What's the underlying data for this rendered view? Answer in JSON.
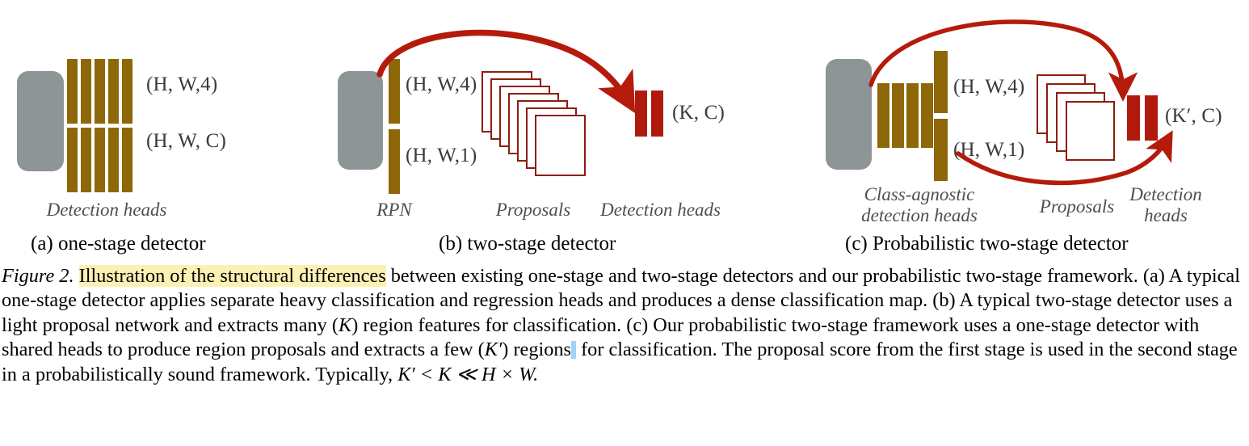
{
  "figure": {
    "panels": [
      {
        "id": "a",
        "subcaption": "(a) one-stage detector",
        "shape_labels": [
          "(H, W,4)",
          "(H, W, C)"
        ],
        "part_captions": [
          "Detection heads"
        ]
      },
      {
        "id": "b",
        "subcaption": "(b) two-stage detector",
        "shape_labels": [
          "(H, W,4)",
          "(H, W,1)",
          "(K, C)"
        ],
        "part_captions": [
          "RPN",
          "Proposals",
          "Detection heads"
        ]
      },
      {
        "id": "c",
        "subcaption": "(c) Probabilistic two-stage detector",
        "shape_labels": [
          "(H, W,4)",
          "(H, W,1)",
          "(K′, C)"
        ],
        "part_captions": [
          "Class-agnostic",
          "detection heads",
          "Proposals",
          "Detection",
          "heads"
        ]
      }
    ],
    "colors": {
      "backbone": "#8e9596",
      "head_bar": "#8d6708",
      "detection_head": "#b01a0c",
      "proposal_outline": "#8e1d0e",
      "arrow": "#b41b0b",
      "highlight": "#fdf0b4",
      "selection": "#9fd2f4"
    },
    "counts": {
      "panel_a_head_bars_per_row": 5,
      "panel_a_rows": 2,
      "panel_b_rpn_bars": 2,
      "panel_b_proposals": 7,
      "panel_b_detection_head_bars": 2,
      "panel_c_shared_head_bars": 4,
      "panel_c_output_bars": 2,
      "panel_c_proposals": 4,
      "panel_c_detection_head_bars": 2
    }
  },
  "caption": {
    "figure_name": "Figure 2.",
    "highlighted": "Illustration of the structural differences",
    "rest_line1": " between existing one-stage and two-stage detectors and our probabilistic two-stage",
    "line2": "framework. (a) A typical one-stage detector applies separate heavy classification and regression heads and produces a dense classification",
    "line3_pre": "map. (b) A typical two-stage detector uses a light proposal network and extracts many (",
    "line3_math1": "K",
    "line3_mid": ") region features for classification. (c) Our",
    "line4_pre": "probabilistic two-stage framework uses a one-stage detector with shared heads to produce region proposals and extracts a few (",
    "line4_math": "K′",
    "line4_post": ") regions",
    "line5": "for classification. The proposal score from the first stage is used in the second stage in a probabilistically sound framework. Typically,",
    "line6": "K′ < K ≪ H × W."
  }
}
